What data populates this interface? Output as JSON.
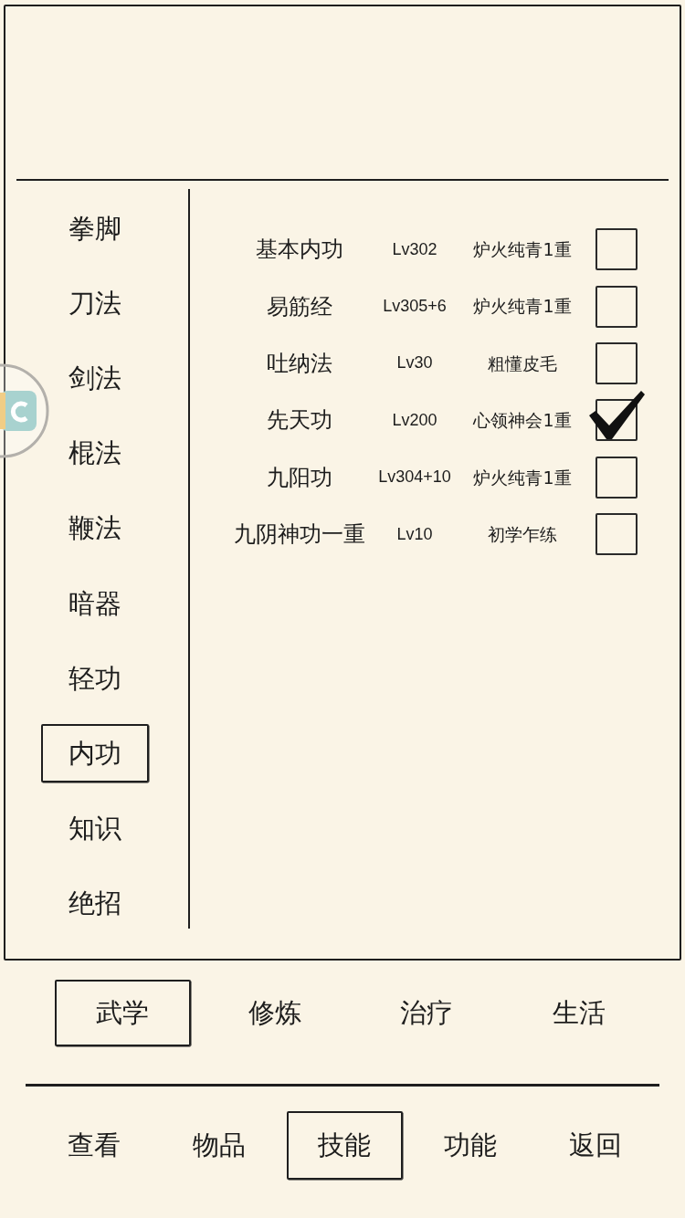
{
  "categories": [
    {
      "label": "拳脚",
      "selected": false
    },
    {
      "label": "刀法",
      "selected": false
    },
    {
      "label": "剑法",
      "selected": false
    },
    {
      "label": "棍法",
      "selected": false
    },
    {
      "label": "鞭法",
      "selected": false
    },
    {
      "label": "暗器",
      "selected": false
    },
    {
      "label": "轻功",
      "selected": false
    },
    {
      "label": "内功",
      "selected": true
    },
    {
      "label": "知识",
      "selected": false
    },
    {
      "label": "绝招",
      "selected": false
    }
  ],
  "skills": [
    {
      "name": "基本内功",
      "grade": "Lv302",
      "realm": "炉火纯青1重",
      "checked": false
    },
    {
      "name": "易筋经",
      "grade": "Lv305+6",
      "realm": "炉火纯青1重",
      "checked": false
    },
    {
      "name": "吐纳法",
      "grade": "Lv30",
      "realm": "粗懂皮毛",
      "checked": false
    },
    {
      "name": "先天功",
      "grade": "Lv200",
      "realm": "心领神会1重",
      "checked": true
    },
    {
      "name": "九阳功",
      "grade": "Lv304+10",
      "realm": "炉火纯青1重",
      "checked": false
    },
    {
      "name": "九阴神功一重",
      "grade": "Lv10",
      "realm": "初学乍练",
      "checked": false
    }
  ],
  "section_tabs": [
    {
      "label": "武学",
      "selected": true
    },
    {
      "label": "修炼",
      "selected": false
    },
    {
      "label": "治疗",
      "selected": false
    },
    {
      "label": "生活",
      "selected": false
    }
  ],
  "menu": [
    {
      "label": "查看",
      "selected": false
    },
    {
      "label": "物品",
      "selected": false
    },
    {
      "label": "技能",
      "selected": true
    },
    {
      "label": "功能",
      "selected": false
    },
    {
      "label": "返回",
      "selected": false
    }
  ]
}
